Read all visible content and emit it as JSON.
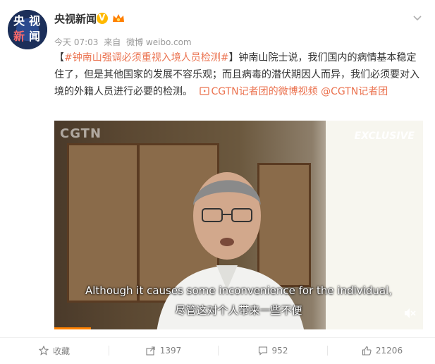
{
  "account": {
    "name": "央视新闻",
    "avatar_chars": [
      "央",
      "视",
      "新",
      "闻"
    ]
  },
  "meta": {
    "time": "今天 07:03",
    "source_prefix": "来自",
    "source": "微博 weibo.com"
  },
  "post": {
    "bracket_open": "【",
    "hashtag": "#钟南山强调必须重视入境人员检测#",
    "bracket_close": "】",
    "body": "钟南山院士说，我们国内的病情基本稳定住了，但是其他国家的发展不容乐观；而且病毒的潜伏期因人而异，我们必须要对入境的外籍人员进行必要的检测。",
    "video_link": "CGTN记者团的微博视频",
    "mention": "@CGTN记者团"
  },
  "video": {
    "watermark": "CGTN",
    "badge": "EXCLUSIVE",
    "subtitle_en": "Although it causes some inconvenience for the individual,",
    "subtitle_cn": "尽管这对个人带来一些不便",
    "progress": 0.1
  },
  "actions": {
    "favorite": "收藏",
    "repost": "1397",
    "comment": "952",
    "like": "21206"
  },
  "colors": {
    "link": "#eb7350",
    "progress": "#ff8200",
    "badge": "#ffb900"
  }
}
